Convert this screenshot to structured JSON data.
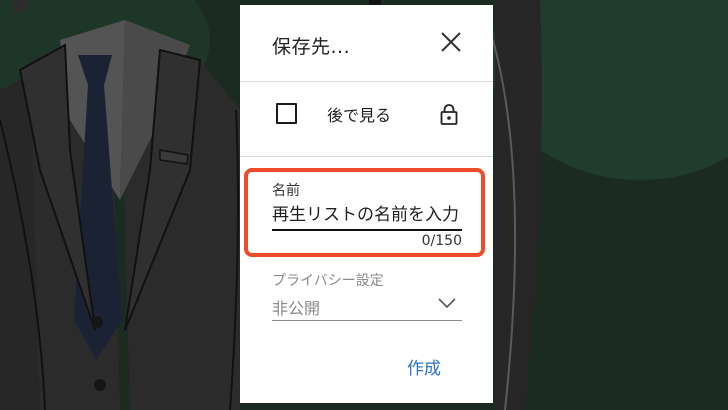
{
  "dialog": {
    "title": "保存先...",
    "playlists": [
      {
        "label": "後で見る",
        "checked": false,
        "privacy_icon": "lock-icon"
      }
    ],
    "name_field": {
      "label": "名前",
      "value": "",
      "placeholder": "再生リストの名前を入力",
      "counter": "0/150"
    },
    "privacy": {
      "label": "プライバシー設定",
      "value": "非公開"
    },
    "create_label": "作成"
  },
  "colors": {
    "accent_blue": "#2a72c8",
    "highlight_red": "#ee4b2b",
    "background_green": "#1e3a2c"
  }
}
